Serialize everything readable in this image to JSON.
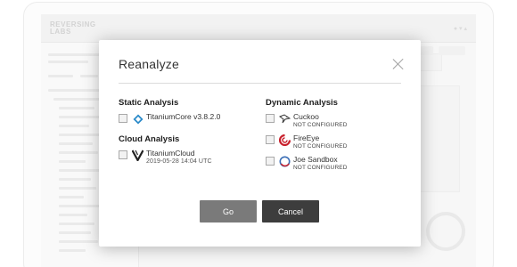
{
  "modal": {
    "title": "Reanalyze",
    "static_analysis": {
      "title": "Static Analysis",
      "items": [
        {
          "name": "TitaniumCore v3.8.2.0",
          "icon": "diamond-icon",
          "checked": false
        }
      ]
    },
    "cloud_analysis": {
      "title": "Cloud Analysis",
      "items": [
        {
          "name": "TitaniumCloud",
          "detail": "2019-05-28 14:04 UTC",
          "icon": "v-logo-icon",
          "checked": false
        }
      ]
    },
    "dynamic_analysis": {
      "title": "Dynamic Analysis",
      "items": [
        {
          "name": "Cuckoo",
          "status": "NOT CONFIGURED",
          "icon": "cuckoo-bird-icon",
          "checked": false
        },
        {
          "name": "FireEye",
          "status": "NOT CONFIGURED",
          "icon": "fireeye-icon",
          "checked": false
        },
        {
          "name": "Joe Sandbox",
          "status": "NOT CONFIGURED",
          "icon": "joe-sandbox-icon",
          "checked": false
        }
      ]
    },
    "buttons": {
      "go": "Go",
      "cancel": "Cancel"
    }
  },
  "background": {
    "logo": "REVERSING LABS",
    "colors": {
      "go_button": "#7a7a7a",
      "cancel_button": "#3d3d3d",
      "fireeye_red": "#c8202c",
      "diamond_blue": "#2b8ac9"
    }
  }
}
